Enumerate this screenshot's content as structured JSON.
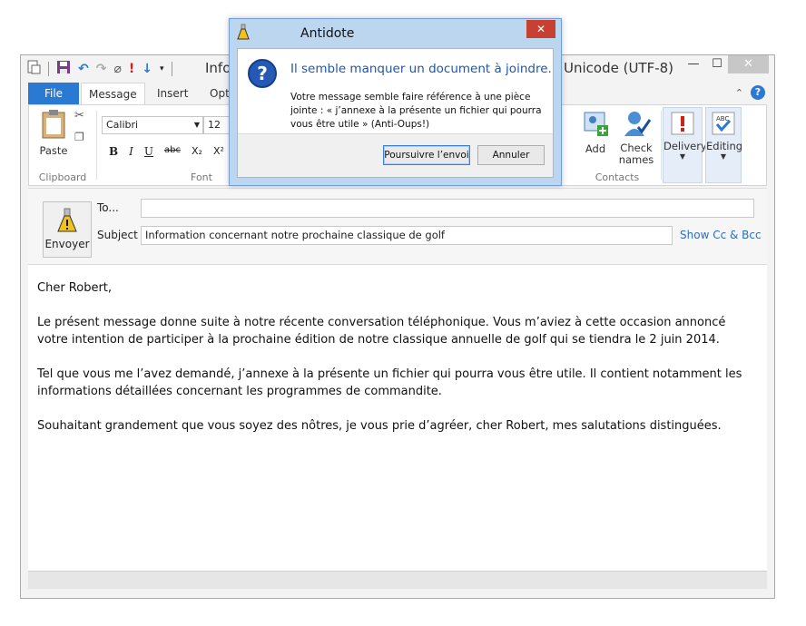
{
  "window": {
    "title_left": "Info",
    "title_right": "Unicode (UTF-8)"
  },
  "tabs": {
    "file": "File",
    "message": "Message",
    "insert": "Insert",
    "options": "Opt"
  },
  "ribbon": {
    "paste_label": "Paste",
    "clipboard_group": "Clipboard",
    "font_name": "Calibri",
    "font_size": "12",
    "font_group": "Font",
    "bold": "B",
    "italic": "I",
    "underline": "U",
    "strike": "abc",
    "subscript": "X₂",
    "superscript": "X²",
    "add_label": "Add",
    "check_names_line1": "Check",
    "check_names_line2": "names",
    "contacts_group": "Contacts",
    "delivery_label": "Delivery",
    "editing_label": "Editing"
  },
  "compose": {
    "send_label": "Envoyer",
    "to_label": "To...",
    "to_value": "",
    "subject_label": "Subject",
    "subject_value": "Information concernant notre prochaine classique de golf",
    "show_cc_bcc": "Show Cc & Bcc"
  },
  "body": {
    "greeting": "Cher Robert,",
    "p1": "Le présent message donne suite à notre récente conversation téléphonique. Vous m’aviez à cette occasion annoncé votre intention de participer à la prochaine édition de notre classique annuelle de golf qui se tiendra le 2 juin 2014.",
    "p2": "Tel que vous me l’avez demandé, j’annexe à la présente un fichier qui pourra vous être utile. Il contient notamment les informations détaillées concernant les programmes de commandite.",
    "p3": "Souhaitant grandement que vous soyez des nôtres, je vous prie d’agréer, cher Robert, mes salutations distinguées."
  },
  "dialog": {
    "title": "Antidote",
    "heading": "Il semble manquer un document à joindre.",
    "message": "Votre message semble faire référence à une pièce jointe : « j’annexe à la présente un fichier qui pourra vous être utile » (Anti-Oups!)",
    "continue_button": "Poursuivre l’envoi",
    "cancel_button": "Annuler"
  },
  "colors": {
    "accent": "#2a7ad3",
    "dialog_frame": "#bcd6f0",
    "dialog_heading": "#1f57a8",
    "close_red": "#c84032",
    "link": "#2a6fbf"
  }
}
